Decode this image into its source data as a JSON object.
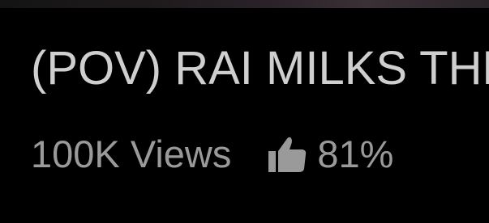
{
  "video": {
    "title": "(POV) RAI MILKS THE",
    "views": "100K Views",
    "like_percent": "81%"
  },
  "icons": {
    "rating": "thumbs-up-icon"
  },
  "colors": {
    "background": "#000000",
    "title_text": "#cfcfcf",
    "meta_text": "#9a9a9a"
  }
}
